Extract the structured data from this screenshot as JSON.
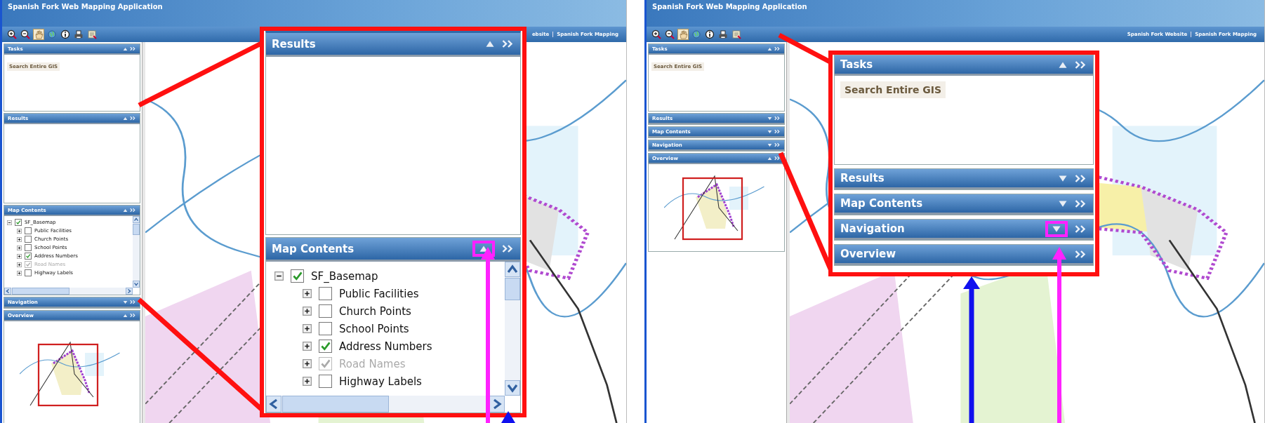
{
  "screens": [
    {
      "title": "Spanish Fork Web Mapping Application",
      "tools": [
        {
          "kind": "zoom_in",
          "selected": false
        },
        {
          "kind": "zoom_out",
          "selected": false
        },
        {
          "kind": "pan",
          "selected": true
        },
        {
          "kind": "full_extent",
          "selected": false
        },
        {
          "kind": "identify",
          "selected": false
        },
        {
          "kind": "print",
          "selected": false
        },
        {
          "kind": "export",
          "selected": false
        }
      ],
      "links": [
        "ebsite",
        "Spanish Fork Mapping"
      ],
      "panels": [
        {
          "title": "Tasks",
          "expanded": true,
          "kind": "tasks",
          "items": [
            "Search Entire GIS"
          ]
        },
        {
          "title": "Results",
          "expanded": true,
          "kind": "empty"
        },
        {
          "title": "Map Contents",
          "expanded": true,
          "kind": "layers",
          "layers": [
            {
              "name": "SF_Basemap",
              "checked": true,
              "expanded": true,
              "disabled": false,
              "children": [
                {
                  "name": "Public Facilities",
                  "checked": false,
                  "expanded": false,
                  "disabled": false
                },
                {
                  "name": "Church Points",
                  "checked": false,
                  "expanded": false,
                  "disabled": false
                },
                {
                  "name": "School Points",
                  "checked": false,
                  "expanded": false,
                  "disabled": false
                },
                {
                  "name": "Address Numbers",
                  "checked": true,
                  "expanded": false,
                  "disabled": false
                },
                {
                  "name": "Road Names",
                  "checked": true,
                  "expanded": false,
                  "disabled": true
                },
                {
                  "name": "Highway Labels",
                  "checked": false,
                  "expanded": false,
                  "disabled": false
                }
              ]
            }
          ]
        },
        {
          "title": "Navigation",
          "expanded": false
        },
        {
          "title": "Overview",
          "expanded": true,
          "kind": "overview"
        }
      ]
    },
    {
      "title": "Spanish Fork Web Mapping Application",
      "tools": [
        {
          "kind": "zoom_in",
          "selected": false
        },
        {
          "kind": "zoom_out",
          "selected": false
        },
        {
          "kind": "pan",
          "selected": true
        },
        {
          "kind": "full_extent",
          "selected": false
        },
        {
          "kind": "identify",
          "selected": false
        },
        {
          "kind": "print",
          "selected": false
        },
        {
          "kind": "export",
          "selected": false
        }
      ],
      "links": [
        "Spanish Fork Website",
        "Spanish Fork Mapping"
      ],
      "panels": [
        {
          "title": "Tasks",
          "expanded": true,
          "kind": "tasks",
          "items": [
            "Search Entire GIS"
          ]
        },
        {
          "title": "Results",
          "expanded": false
        },
        {
          "title": "Map Contents",
          "expanded": false
        },
        {
          "title": "Navigation",
          "expanded": false
        },
        {
          "title": "Overview",
          "expanded": true,
          "kind": "overview"
        }
      ]
    }
  ],
  "callouts": [
    {
      "panels": [
        {
          "title": "Results",
          "expanded": true,
          "kind": "empty",
          "highlighted": false
        },
        {
          "title": "Map Contents",
          "expanded": true,
          "highlighted": true,
          "kind": "layers",
          "layers": [
            {
              "name": "SF_Basemap",
              "checked": true,
              "expanded": true,
              "disabled": false,
              "children": [
                {
                  "name": "Public Facilities",
                  "checked": false,
                  "expanded": false,
                  "disabled": false
                },
                {
                  "name": "Church Points",
                  "checked": false,
                  "expanded": false,
                  "disabled": false
                },
                {
                  "name": "School Points",
                  "checked": false,
                  "expanded": false,
                  "disabled": false
                },
                {
                  "name": "Address Numbers",
                  "checked": true,
                  "expanded": false,
                  "disabled": false
                },
                {
                  "name": "Road Names",
                  "checked": true,
                  "expanded": false,
                  "disabled": true
                },
                {
                  "name": "Highway Labels",
                  "checked": false,
                  "expanded": false,
                  "disabled": false
                }
              ]
            }
          ]
        }
      ]
    },
    {
      "panels": [
        {
          "title": "Tasks",
          "expanded": true,
          "kind": "tasks",
          "highlighted": false,
          "items": [
            "Search Entire GIS"
          ]
        },
        {
          "title": "Results",
          "expanded": false,
          "highlighted": false
        },
        {
          "title": "Map Contents",
          "expanded": false,
          "highlighted": false
        },
        {
          "title": "Navigation",
          "expanded": false,
          "highlighted": true
        },
        {
          "title": "Overview",
          "highlighted": false
        }
      ]
    }
  ]
}
